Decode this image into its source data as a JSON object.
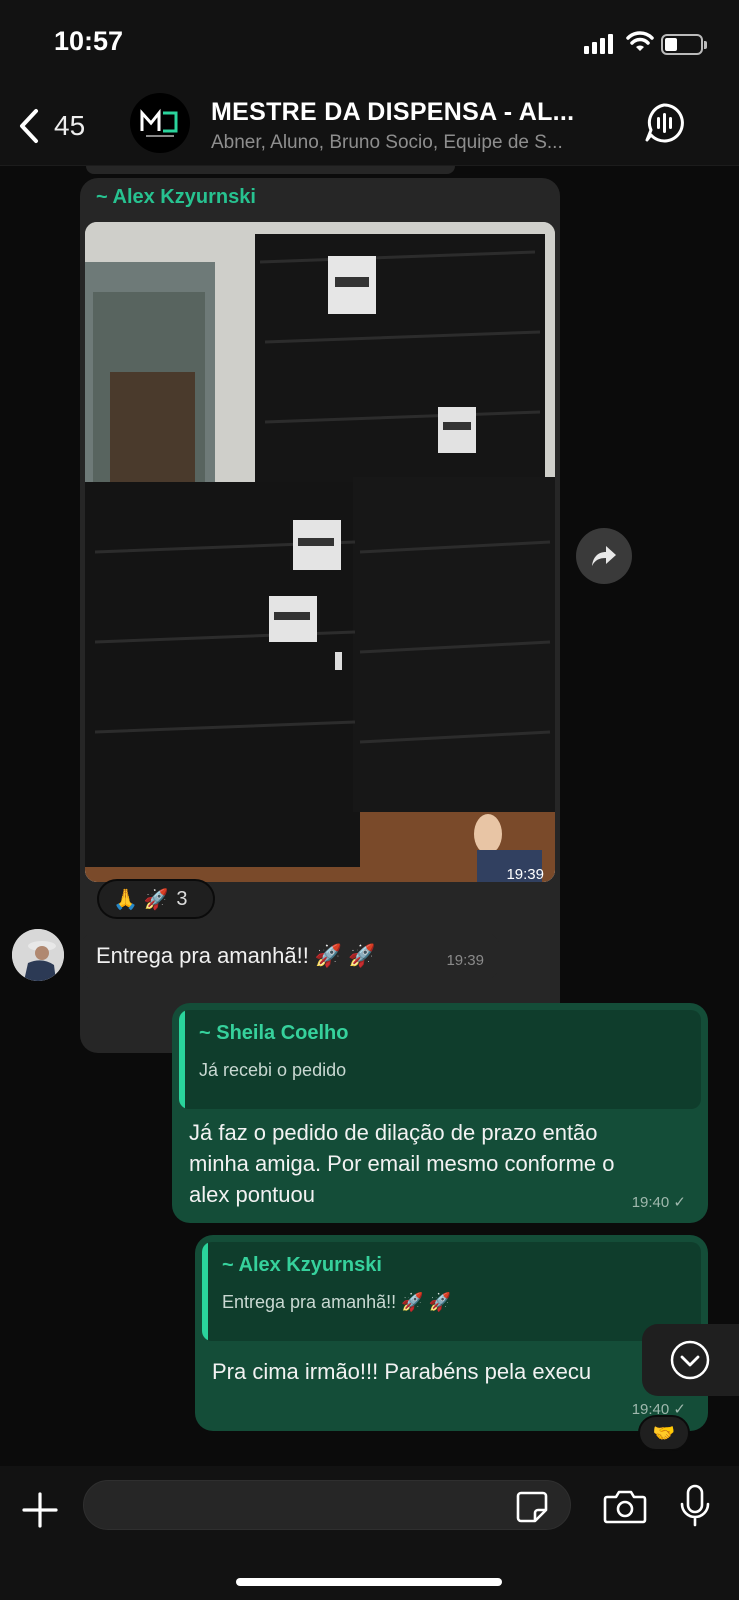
{
  "status": {
    "time": "10:57"
  },
  "header": {
    "back_count": "45",
    "group_name": "MESTRE DA DISPENSA - AL...",
    "members": "Abner, Aluno, Bruno Socio, Equipe de S..."
  },
  "messages": {
    "photo_msg": {
      "sender": "~ Alex Kzyurnski",
      "time": "19:39",
      "reactions": "🙏 🚀",
      "reaction_count": "3"
    },
    "text_in": {
      "text": "Entrega pra amanhã!! 🚀 🚀",
      "time": "19:39"
    },
    "reply1": {
      "quote_name": "~ Sheila Coelho",
      "quote_text": "Já recebi o pedido",
      "lines": [
        "Já faz o pedido de dilação de prazo então",
        "minha amiga. Por email mesmo conforme o",
        "alex pontuou"
      ],
      "time": "19:40"
    },
    "reply2": {
      "quote_name": "~ Alex Kzyurnski",
      "quote_text": "Entrega pra amanhã!! 🚀 🚀",
      "text": "Pra cima irmão!!! Parabéns pela execu",
      "time": "19:40",
      "reaction": "🤝"
    }
  },
  "composer": {
    "value": "",
    "placeholder": ""
  },
  "colors": {
    "accent": "#27c290",
    "outgoing": "#144d38",
    "incoming": "#262626"
  }
}
